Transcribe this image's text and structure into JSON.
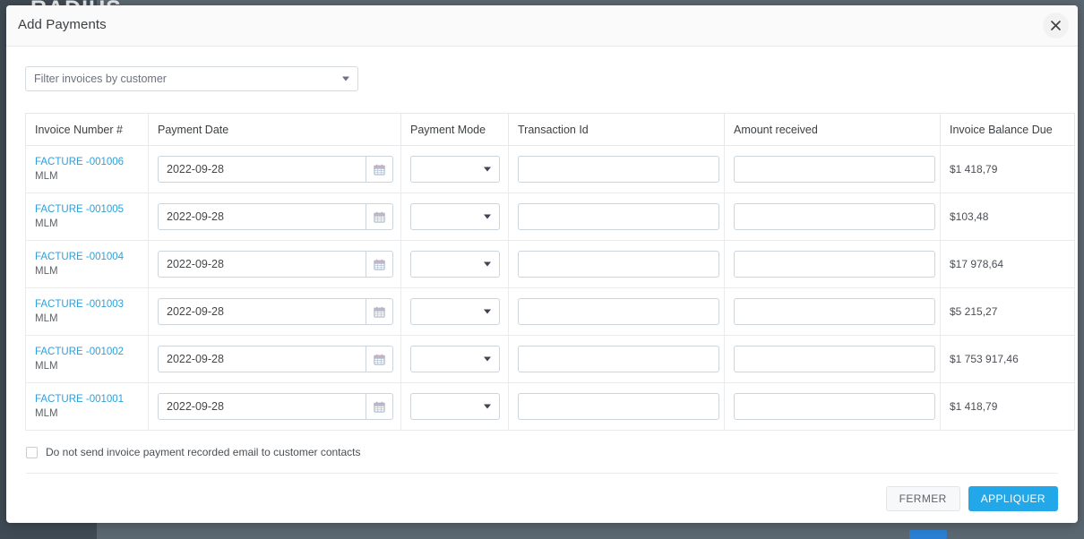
{
  "backdrop": {
    "brand": "RADIUS"
  },
  "modal": {
    "title": "Add Payments",
    "close_icon": "close-icon"
  },
  "filter": {
    "placeholder": "Filter invoices by customer",
    "value": "",
    "caret_icon": "chevron-down-icon"
  },
  "table": {
    "columns": [
      "Invoice Number #",
      "Payment Date",
      "Payment Mode",
      "Transaction Id",
      "Amount received",
      "Invoice Balance Due"
    ],
    "rows": [
      {
        "invoice_number": "FACTURE -001006",
        "customer": "MLM",
        "payment_date": "2022-09-28",
        "payment_mode": "",
        "transaction_id": "",
        "amount_received": "",
        "balance_due": "$1 418,79"
      },
      {
        "invoice_number": "FACTURE -001005",
        "customer": "MLM",
        "payment_date": "2022-09-28",
        "payment_mode": "",
        "transaction_id": "",
        "amount_received": "",
        "balance_due": "$103,48"
      },
      {
        "invoice_number": "FACTURE -001004",
        "customer": "MLM",
        "payment_date": "2022-09-28",
        "payment_mode": "",
        "transaction_id": "",
        "amount_received": "",
        "balance_due": "$17 978,64"
      },
      {
        "invoice_number": "FACTURE -001003",
        "customer": "MLM",
        "payment_date": "2022-09-28",
        "payment_mode": "",
        "transaction_id": "",
        "amount_received": "",
        "balance_due": "$5 215,27"
      },
      {
        "invoice_number": "FACTURE -001002",
        "customer": "MLM",
        "payment_date": "2022-09-28",
        "payment_mode": "",
        "transaction_id": "",
        "amount_received": "",
        "balance_due": "$1 753 917,46"
      },
      {
        "invoice_number": "FACTURE -001001",
        "customer": "MLM",
        "payment_date": "2022-09-28",
        "payment_mode": "",
        "transaction_id": "",
        "amount_received": "",
        "balance_due": "$1 418,79"
      }
    ],
    "date_icon": "calendar-icon",
    "mode_caret_icon": "chevron-down-icon"
  },
  "options": {
    "no_email_label": "Do not send invoice payment recorded email to customer contacts",
    "no_email_checked": false
  },
  "footer": {
    "close_label": "FERMER",
    "apply_label": "APPLIQUER"
  },
  "colors": {
    "accent": "#22a7e8",
    "link": "#2f9fd8",
    "backdrop": "#5b6770",
    "sidebar": "#3f4a54"
  }
}
